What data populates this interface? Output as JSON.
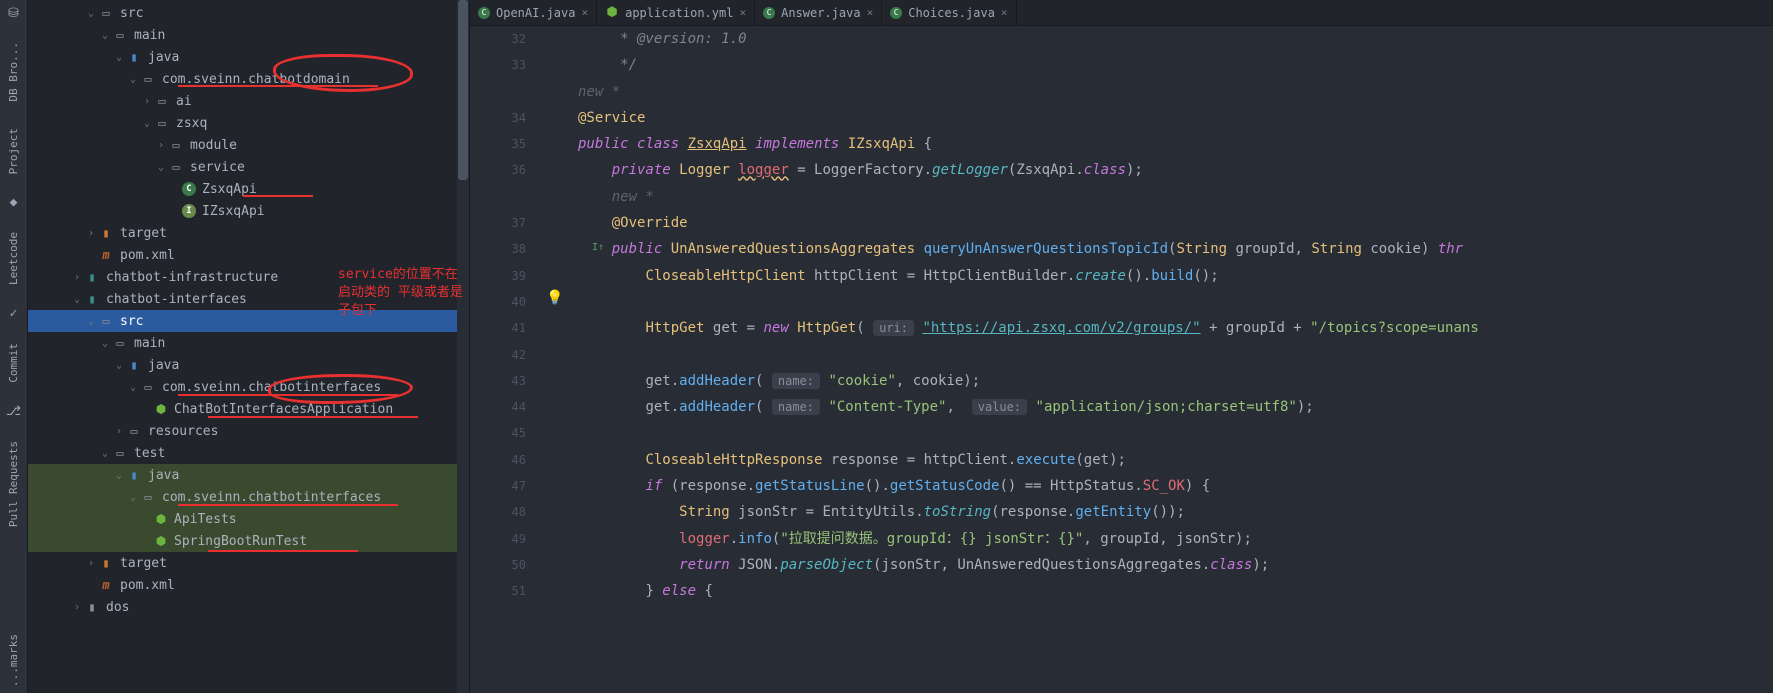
{
  "leftbar": {
    "tools": [
      "DB Bro...",
      "Project",
      "Leetcode",
      "Commit",
      "Pull Requests",
      "...marks"
    ]
  },
  "tree": {
    "rows": [
      {
        "indent": 4,
        "arrow": "down",
        "icon": "folder-open",
        "label": "src"
      },
      {
        "indent": 5,
        "arrow": "down",
        "icon": "folder-open",
        "label": "main"
      },
      {
        "indent": 6,
        "arrow": "down",
        "icon": "folder-blue",
        "label": "java"
      },
      {
        "indent": 7,
        "arrow": "down",
        "icon": "package",
        "label": "com.sveinn.chatbotdomain"
      },
      {
        "indent": 8,
        "arrow": "right",
        "icon": "package",
        "label": "ai"
      },
      {
        "indent": 8,
        "arrow": "down",
        "icon": "package",
        "label": "zsxq"
      },
      {
        "indent": 9,
        "arrow": "right",
        "icon": "package",
        "label": "module"
      },
      {
        "indent": 9,
        "arrow": "down",
        "icon": "package",
        "label": "service"
      },
      {
        "indent": 10,
        "arrow": "",
        "icon": "class",
        "label": "ZsxqApi"
      },
      {
        "indent": 10,
        "arrow": "",
        "icon": "interface",
        "label": "IZsxqApi"
      },
      {
        "indent": 4,
        "arrow": "right",
        "icon": "folder-orange",
        "label": "target"
      },
      {
        "indent": 4,
        "arrow": "",
        "icon": "maven",
        "label": "pom.xml"
      },
      {
        "indent": 3,
        "arrow": "right",
        "icon": "folder-teal",
        "label": "chatbot-infrastructure"
      },
      {
        "indent": 3,
        "arrow": "down",
        "icon": "folder-teal",
        "label": "chatbot-interfaces"
      },
      {
        "indent": 4,
        "arrow": "down",
        "icon": "folder-open",
        "label": "src",
        "selected": true
      },
      {
        "indent": 5,
        "arrow": "down",
        "icon": "folder-open",
        "label": "main"
      },
      {
        "indent": 6,
        "arrow": "down",
        "icon": "folder-blue",
        "label": "java"
      },
      {
        "indent": 7,
        "arrow": "down",
        "icon": "package",
        "label": "com.sveinn.chatbotinterfaces"
      },
      {
        "indent": 8,
        "arrow": "",
        "icon": "spring",
        "label": "ChatBotInterfacesApplication"
      },
      {
        "indent": 6,
        "arrow": "right",
        "icon": "folder-open",
        "label": "resources"
      },
      {
        "indent": 5,
        "arrow": "down",
        "icon": "folder-open",
        "label": "test"
      },
      {
        "indent": 6,
        "arrow": "down",
        "icon": "folder-blue",
        "label": "java",
        "hl": true
      },
      {
        "indent": 7,
        "arrow": "down",
        "icon": "package",
        "label": "com.sveinn.chatbotinterfaces",
        "hl": true
      },
      {
        "indent": 8,
        "arrow": "",
        "icon": "spring",
        "label": "ApiTests",
        "hl": true
      },
      {
        "indent": 8,
        "arrow": "",
        "icon": "spring",
        "label": "SpringBootRunTest",
        "hl": true
      },
      {
        "indent": 4,
        "arrow": "right",
        "icon": "folder-orange",
        "label": "target"
      },
      {
        "indent": 4,
        "arrow": "",
        "icon": "maven",
        "label": "pom.xml"
      },
      {
        "indent": 3,
        "arrow": "right",
        "icon": "folder",
        "label": "dos"
      }
    ]
  },
  "annotations": {
    "red_text": "service的位置不在启动类的\n平级或者是子包下"
  },
  "tabs": [
    {
      "icon": "class",
      "label": "OpenAI.java",
      "active": false
    },
    {
      "icon": "yml",
      "label": "application.yml",
      "active": false
    },
    {
      "icon": "class",
      "label": "Answer.java",
      "active": false
    },
    {
      "icon": "class",
      "label": "Choices.java",
      "active": false
    }
  ],
  "code": {
    "lineNumbers": [
      "32",
      "33",
      "",
      "34",
      "35",
      "36",
      "",
      "37",
      "38",
      "39",
      "40",
      "41",
      "42",
      "43",
      "44",
      "45",
      "46",
      "47",
      "48",
      "49",
      "50",
      "51",
      ""
    ],
    "lines": {
      "l32": " * @version: 1.0",
      "l33": " */",
      "lnew1": "new *",
      "l34": "@Service",
      "l35_pub": "public",
      "l35_class": "class",
      "l35_name": "ZsxqApi",
      "l35_impl": "implements",
      "l35_iface": "IZsxqApi",
      "l36_priv": "private",
      "l36_type": "Logger",
      "l36_fld": "logger",
      "l36_eq": " = LoggerFactory.",
      "l36_get": "getLogger",
      "l36_arg": "(ZsxqApi.",
      "l36_cl": "class",
      "l36_end": ");",
      "lnew2": "new *",
      "l37": "@Override",
      "l38_pub": "public",
      "l38_ret": "UnAnsweredQuestionsAggregates",
      "l38_m": "queryUnAnswerQuestionsTopicId",
      "l38_p1t": "String",
      "l38_p1n": "groupId",
      "l38_p2t": "String",
      "l38_p2n": "cookie",
      "l38_th": "thr",
      "l39_t": "CloseableHttpClient",
      "l39_v": "httpClient",
      "l39_b": " = HttpClientBuilder.",
      "l39_c": "create",
      "l39_d": "().",
      "l39_e": "build",
      "l39_f": "();",
      "l41_t": "HttpGet",
      "l41_v": "get",
      "l41_eq": " = ",
      "l41_new": "new",
      "l41_c": "HttpGet",
      "l41_h1": "uri:",
      "l41_s1": "\"https://api.zsxq.com/v2/groups/\"",
      "l41_plus": " + groupId + ",
      "l41_s2": "\"/topics?scope=unans",
      "l43_a": "get.",
      "l43_m": "addHeader",
      "l43_h": "name:",
      "l43_s1": "\"cookie\"",
      "l43_c": ", cookie);",
      "l44_a": "get.",
      "l44_m": "addHeader",
      "l44_h1": "name:",
      "l44_s1": "\"Content-Type\"",
      "l44_c": ", ",
      "l44_h2": "value:",
      "l44_s2": "\"application/json;charset=utf8\"",
      "l44_e": ");",
      "l46_t": "CloseableHttpResponse",
      "l46_v": "response",
      "l46_b": " = httpClient.",
      "l46_m": "execute",
      "l46_e": "(get);",
      "l47_if": "if",
      "l47_a": " (response.",
      "l47_m1": "getStatusLine",
      "l47_b": "().",
      "l47_m2": "getStatusCode",
      "l47_c": "() == HttpStatus.",
      "l47_f": "SC_OK",
      "l47_e": ") {",
      "l48_t": "String",
      "l48_v": "jsonStr",
      "l48_b": " = EntityUtils.",
      "l48_m": "toString",
      "l48_c": "(response.",
      "l48_m2": "getEntity",
      "l48_e": "());",
      "l49_a": "logger",
      "l49_b": ".",
      "l49_m": "info",
      "l49_c": "(",
      "l49_s": "\"拉取提问数据。groupId：{} jsonStr：{}\"",
      "l49_e": ", groupId, jsonStr);",
      "l50_r": "return",
      "l50_a": " JSON.",
      "l50_m": "parseObject",
      "l50_b": "(jsonStr, UnAnsweredQuestionsAggregates.",
      "l50_c": "class",
      "l50_e": ");",
      "l51_a": "} ",
      "l51_e": "else",
      "l51_b": " {"
    }
  }
}
